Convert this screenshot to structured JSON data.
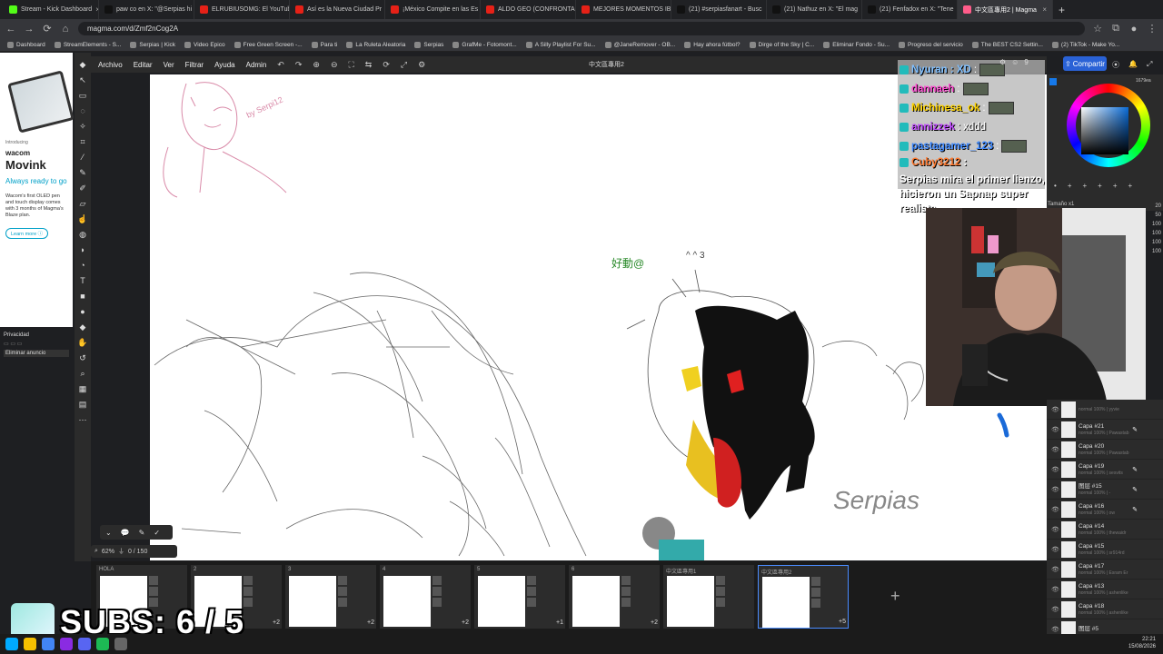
{
  "tabs": [
    {
      "label": "Stream - Kick Dashboard",
      "color": "#53fc18"
    },
    {
      "label": "paw co en X: \"@Serpias hi",
      "color": "#111"
    },
    {
      "label": "ELRUBIUSOMG: El YouTub",
      "color": "#e62117"
    },
    {
      "label": "Así es la Nueva Ciudad Pr",
      "color": "#e62117"
    },
    {
      "label": "¡México Compite en las Es",
      "color": "#e62117"
    },
    {
      "label": "ALDO GEO (CONFRONTA",
      "color": "#e62117"
    },
    {
      "label": "MEJORES MOMENTOS IBA",
      "color": "#e62117"
    },
    {
      "label": "(21) #serpiasfanart - Busc",
      "color": "#111"
    },
    {
      "label": "(21) Nathuz en X: \"El mag",
      "color": "#111"
    },
    {
      "label": "(21) Fenfadox en X: \"Tene",
      "color": "#111"
    },
    {
      "label": "中文區專用2 | Magma",
      "color": "#ff5c8a",
      "active": true
    }
  ],
  "url": "magma.com/d/Zmf2nCog2A",
  "bookmarks": [
    "Dashboard",
    "StreamElements - S...",
    "Serpias | Kick",
    "Video Epico",
    "Free Green Screen -...",
    "Para ti",
    "La Ruleta Aleatoria",
    "Serpias",
    "GrafMe - Fotomont...",
    "A Silly Playlist For Su...",
    "@JaneRemover - OB...",
    "Hay ahora fútbol?",
    "Dirge of the Sky | C...",
    "Eliminar Fondo - Su...",
    "Progreso del servicio",
    "The BEST CS2 Settin...",
    "(2) TikTok - Make Yo..."
  ],
  "ad": {
    "intro": "Introducing",
    "brand": "wacom",
    "product": "Movink",
    "tagline": "Always ready to go",
    "body": "Wacom's first OLED pen and touch display comes with 3 months of Magma's Blaze plan.",
    "learn": "Learn more ⓘ"
  },
  "privacy": {
    "label": "Privacidad",
    "remove": "Eliminar anuncio"
  },
  "menu": [
    "Archivo",
    "Editar",
    "Ver",
    "Filtrar",
    "Ayuda",
    "Admin"
  ],
  "doc_title": "中文區專用2",
  "share": "Compartir",
  "chat": [
    {
      "user": "Nyuran : XD",
      "color": "#7fbfff",
      "text": ""
    },
    {
      "user": "dannaeh",
      "color": "#ff4ad2",
      "text": ""
    },
    {
      "user": "Michinesa_ok",
      "color": "#ffd400",
      "text": ""
    },
    {
      "user": "annizzek",
      "color": "#c04aff",
      "text": "xddd"
    },
    {
      "user": "pastagamer_123",
      "color": "#3f8aff",
      "text": ""
    },
    {
      "user": "Cuby3212",
      "color": "#ff7a30",
      "text": "Serpias mira el primer lienzo, hicieron un Sapnap super realista"
    }
  ],
  "color_hex": "1679ea",
  "brush_size_label": "Tamaño x1",
  "size_ticks": [
    "20",
    "50",
    "100",
    "100",
    "100",
    "100"
  ],
  "layers": [
    {
      "name": "",
      "sub": "normal 100% | yyvie",
      "pen": false
    },
    {
      "name": "Capa #21",
      "sub": "normal 100% | Pawastab",
      "pen": true
    },
    {
      "name": "Capa #20",
      "sub": "normal 100% | Pawastab",
      "pen": false
    },
    {
      "name": "Capa #19",
      "sub": "normal 100% | sesvits",
      "pen": true
    },
    {
      "name": "图层 #15",
      "sub": "normal 100% | -",
      "pen": true
    },
    {
      "name": "Capa #16",
      "sub": "normal 100% | ow",
      "pen": true
    },
    {
      "name": "Capa #14",
      "sub": "normal 100% | thewaidr",
      "pen": false
    },
    {
      "name": "Capa #15",
      "sub": "normal 100% | sr914rd",
      "pen": false
    },
    {
      "name": "Capa #17",
      "sub": "normal 100% | Esram Er",
      "pen": false
    },
    {
      "name": "Capa #13",
      "sub": "normal 100% | ashenlike",
      "pen": false
    },
    {
      "name": "Capa #18",
      "sub": "normal 100% | ashenlike",
      "pen": false
    },
    {
      "name": "图层 #5",
      "sub": "",
      "pen": false
    }
  ],
  "zoom": "62%",
  "counter": "0 / 150",
  "pages": [
    {
      "num": "HOLA",
      "more": ""
    },
    {
      "num": "2",
      "more": "+2"
    },
    {
      "num": "3",
      "more": "+2"
    },
    {
      "num": "4",
      "more": "+2"
    },
    {
      "num": "5",
      "more": "+1"
    },
    {
      "num": "6",
      "more": "+2"
    },
    {
      "num": "中文區專用1",
      "more": ""
    },
    {
      "num": "中文區專用2",
      "more": "+5",
      "active": true
    }
  ],
  "subs": "SUBS: 6 / 5",
  "clock": {
    "time": "22:21",
    "date": "15/08/2026"
  },
  "canvas_texts": {
    "signature": "by Serpi12",
    "chinese": "好動@",
    "serpias": "Serpias",
    "face": "^ ^\n 3"
  }
}
